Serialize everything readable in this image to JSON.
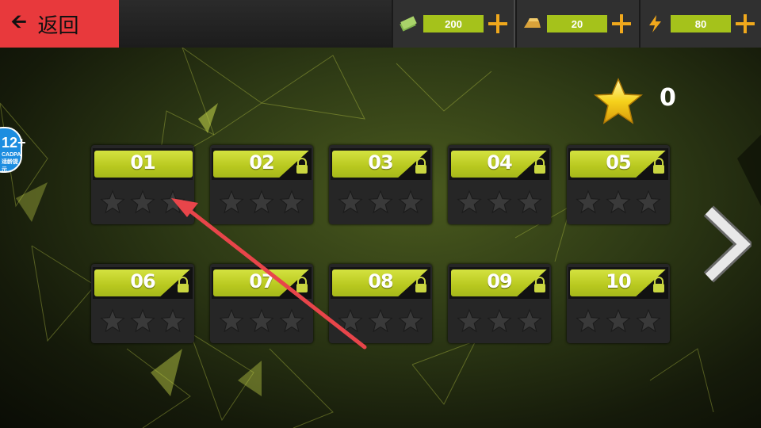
{
  "header": {
    "back_label": "返回",
    "resources": [
      {
        "name": "cash",
        "icon": "cash-icon",
        "value": "200"
      },
      {
        "name": "gold",
        "icon": "gold-bar-icon",
        "value": "20"
      },
      {
        "name": "energy",
        "icon": "lightning-icon",
        "value": "80"
      }
    ]
  },
  "stars_total": "0",
  "age_badge": {
    "number": "12+",
    "caption": "CADPA 适龄提示"
  },
  "levels": [
    {
      "number": "01",
      "locked": false,
      "stars": 0
    },
    {
      "number": "02",
      "locked": true,
      "stars": 0
    },
    {
      "number": "03",
      "locked": true,
      "stars": 0
    },
    {
      "number": "04",
      "locked": true,
      "stars": 0
    },
    {
      "number": "05",
      "locked": true,
      "stars": 0
    },
    {
      "number": "06",
      "locked": true,
      "stars": 0
    },
    {
      "number": "07",
      "locked": true,
      "stars": 0
    },
    {
      "number": "08",
      "locked": true,
      "stars": 0
    },
    {
      "number": "09",
      "locked": true,
      "stars": 0
    },
    {
      "number": "10",
      "locked": true,
      "stars": 0
    }
  ],
  "colors": {
    "accent_red": "#e8393c",
    "level_yellow": "#b8c81f",
    "resource_green": "#a5c21b",
    "plus_orange": "#f0a81c",
    "hint_arrow": "#e8454a"
  }
}
